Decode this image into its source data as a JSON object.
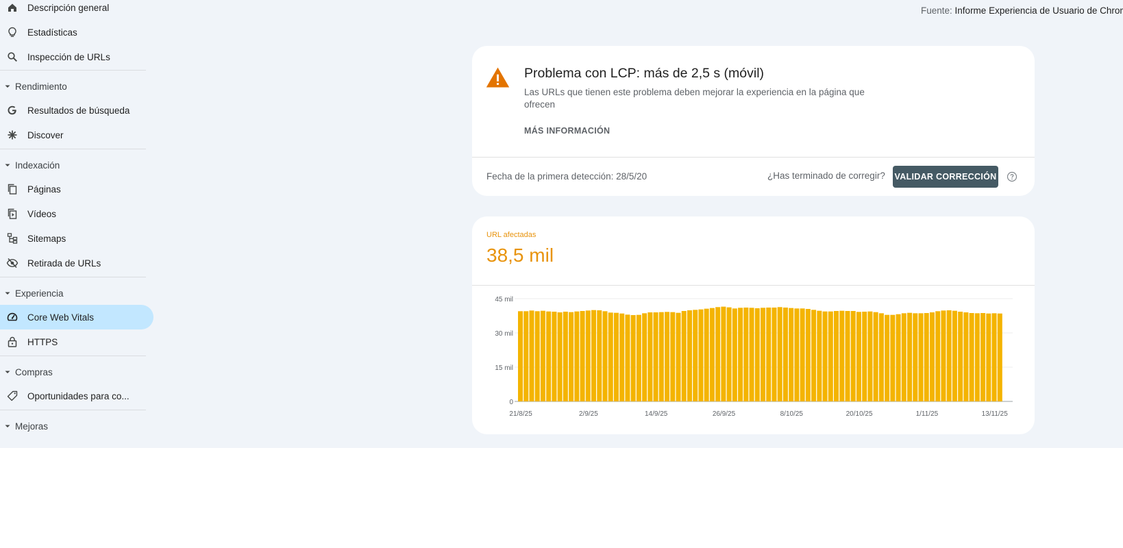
{
  "sidebar": {
    "items_top": [
      {
        "label": "Descripción general",
        "icon": "home-icon"
      },
      {
        "label": "Estadísticas",
        "icon": "lightbulb-icon"
      },
      {
        "label": "Inspección de URLs",
        "icon": "search-icon"
      }
    ],
    "sections": [
      {
        "label": "Rendimiento",
        "items": [
          {
            "label": "Resultados de búsqueda",
            "icon": "google-g-icon"
          },
          {
            "label": "Discover",
            "icon": "asterisk-icon"
          }
        ]
      },
      {
        "label": "Indexación",
        "items": [
          {
            "label": "Páginas",
            "icon": "pages-icon"
          },
          {
            "label": "Vídeos",
            "icon": "video-pages-icon"
          },
          {
            "label": "Sitemaps",
            "icon": "sitemap-icon"
          },
          {
            "label": "Retirada de URLs",
            "icon": "eye-off-icon"
          }
        ]
      },
      {
        "label": "Experiencia",
        "items": [
          {
            "label": "Core Web Vitals",
            "icon": "gauge-icon",
            "active": true
          },
          {
            "label": "HTTPS",
            "icon": "lock-icon"
          }
        ]
      },
      {
        "label": "Compras",
        "items": [
          {
            "label": "Oportunidades para co...",
            "icon": "tag-icon"
          }
        ]
      },
      {
        "label": "Mejoras",
        "items": []
      }
    ]
  },
  "header": {
    "source_prefix": "Fuente:",
    "source_value": "Informe Experiencia de Usuario de Chrom"
  },
  "issue": {
    "title": "Problema con LCP: más de 2,5 s (móvil)",
    "description": "Las URLs que tienen este problema deben mejorar la experiencia en la página que ofrecen",
    "more_info": "MÁS INFORMACIÓN",
    "first_detected": "Fecha de la primera detección: 28/5/20",
    "done_question": "¿Has terminado de corregir?",
    "validate_label": "VALIDAR CORRECCIÓN",
    "accent_color": "#e37400"
  },
  "metric": {
    "label": "URL afectadas",
    "value": "38,5 mil",
    "color": "#e8930c"
  },
  "chart_data": {
    "type": "bar",
    "bar_color": "#f4b400",
    "y_ticks": [
      "45 mil",
      "30 mil",
      "15 mil",
      "0"
    ],
    "ylim": [
      0,
      45000
    ],
    "x_ticks": [
      "21/8/25",
      "2/9/25",
      "14/9/25",
      "26/9/25",
      "8/10/25",
      "20/10/25",
      "1/11/25",
      "13/11/25"
    ],
    "x_start": "2025-08-21",
    "values": [
      39500,
      39500,
      39800,
      39500,
      39700,
      39400,
      39300,
      39000,
      39300,
      39100,
      39400,
      39600,
      39800,
      40000,
      39900,
      39500,
      38900,
      38800,
      38500,
      38000,
      37800,
      37900,
      38600,
      39000,
      39000,
      39100,
      39200,
      39100,
      38800,
      39600,
      39900,
      40100,
      40300,
      40600,
      40900,
      41300,
      41500,
      41200,
      40700,
      41000,
      41100,
      41000,
      40800,
      41000,
      41100,
      41100,
      41300,
      41100,
      40900,
      40700,
      40700,
      40500,
      40100,
      39700,
      39400,
      39400,
      39600,
      39700,
      39600,
      39600,
      39200,
      39300,
      39400,
      39100,
      38600,
      37900,
      37900,
      38200,
      38600,
      38800,
      38600,
      38600,
      38700,
      39000,
      39500,
      39800,
      39900,
      39700,
      39300,
      39000,
      38700,
      38600,
      38700,
      38500,
      38600,
      38500
    ]
  }
}
